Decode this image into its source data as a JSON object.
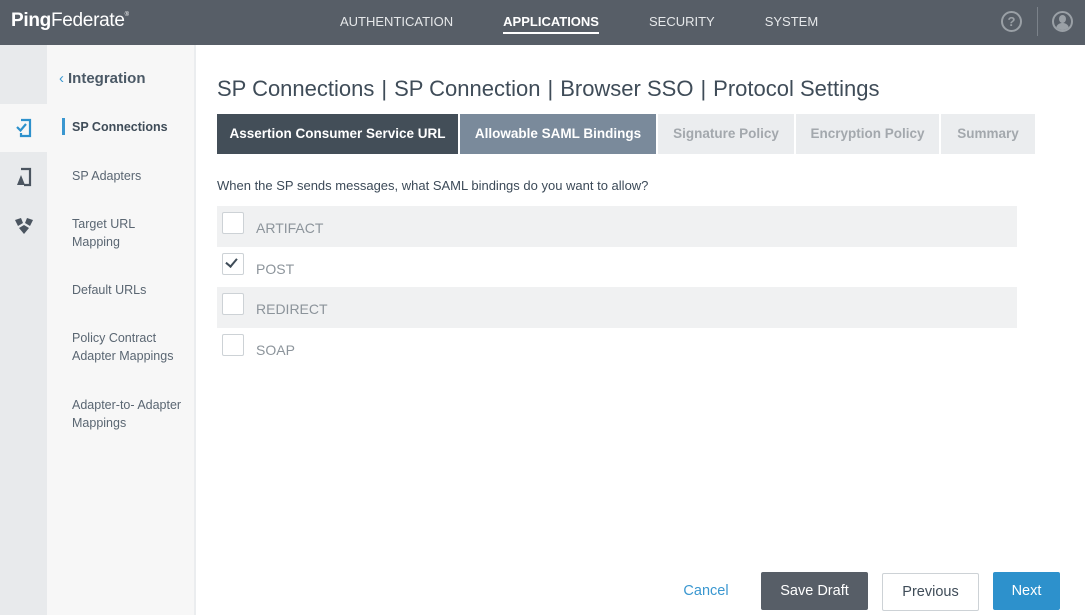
{
  "app": {
    "logo_bold": "Ping",
    "logo_regular": "Federate",
    "logo_mark": "®"
  },
  "topnav": {
    "items": [
      {
        "label": "AUTHENTICATION",
        "active": false
      },
      {
        "label": "APPLICATIONS",
        "active": true
      },
      {
        "label": "SECURITY",
        "active": false
      },
      {
        "label": "SYSTEM",
        "active": false
      }
    ],
    "help_icon": "?",
    "icons": [
      "help-icon",
      "user-profile-icon"
    ]
  },
  "rail": {
    "items": [
      {
        "icon": "sp-connection-check-icon",
        "active": true
      },
      {
        "icon": "sp-adapter-icon",
        "active": false
      },
      {
        "icon": "federation-network-icon",
        "active": false
      }
    ]
  },
  "sidenav": {
    "back_chevron": "‹",
    "back_label": "Integration",
    "items": [
      {
        "label": "SP Connections",
        "active": true
      },
      {
        "label": "SP Adapters",
        "active": false
      },
      {
        "label": "Target URL Mapping",
        "active": false
      },
      {
        "label": "Default URLs",
        "active": false
      },
      {
        "label": "Policy Contract Adapter Mappings",
        "active": false
      },
      {
        "label": "Adapter-to- Adapter Mappings",
        "active": false
      }
    ]
  },
  "main": {
    "breadcrumb": [
      "SP Connections",
      "SP Connection",
      "Browser SSO",
      "Protocol Settings"
    ],
    "separator": "|",
    "tabs": [
      {
        "label": "Assertion Consumer Service URL",
        "state": "done"
      },
      {
        "label": "Allowable SAML Bindings",
        "state": "current"
      },
      {
        "label": "Signature Policy",
        "state": "pending"
      },
      {
        "label": "Encryption Policy",
        "state": "pending"
      },
      {
        "label": "Summary",
        "state": "pending"
      }
    ],
    "question": "When the SP sends messages, what SAML bindings do you want to allow?",
    "bindings": [
      {
        "label": "ARTIFACT",
        "checked": false
      },
      {
        "label": "POST",
        "checked": true
      },
      {
        "label": "REDIRECT",
        "checked": false
      },
      {
        "label": "SOAP",
        "checked": false
      }
    ]
  },
  "footer": {
    "cancel": "Cancel",
    "save_draft": "Save Draft",
    "previous": "Previous",
    "next": "Next"
  },
  "colors": {
    "topbar": "#575e67",
    "accent": "#2d91cc",
    "tab_done": "#434e58",
    "tab_current": "#7a8a9b"
  }
}
